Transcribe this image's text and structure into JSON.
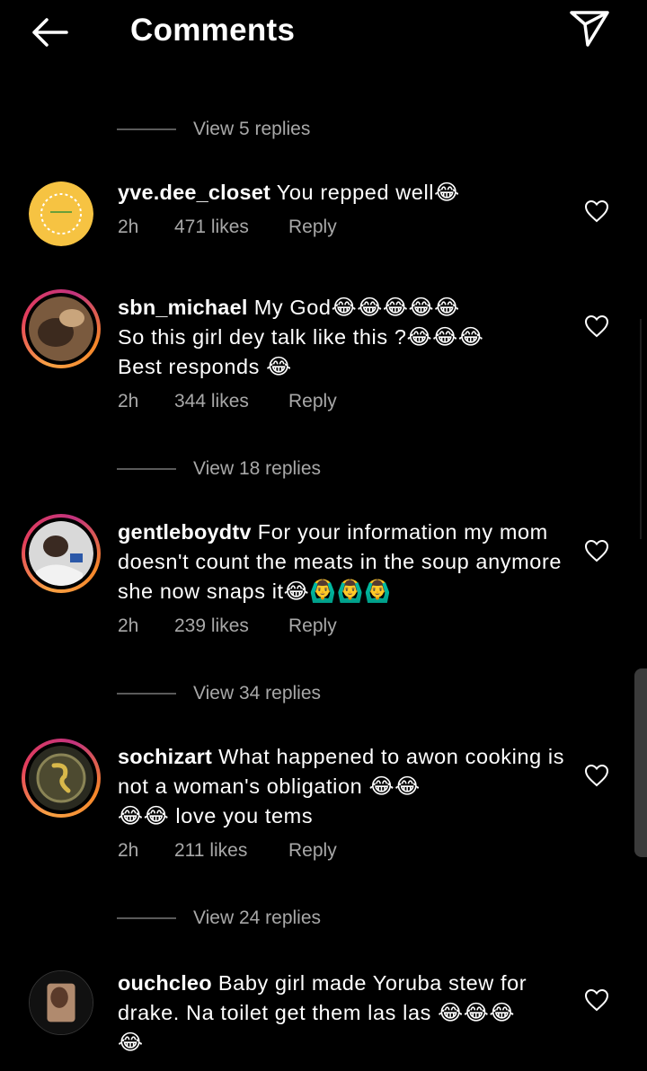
{
  "header": {
    "title": "Comments",
    "back_icon": "arrow-left-icon",
    "share_icon": "paper-plane-icon"
  },
  "view_replies": [
    "View 5 replies",
    "View 18 replies",
    "View 34 replies",
    "View 24 replies"
  ],
  "comments": [
    {
      "username": "yve.dee_closet",
      "text": "You repped well",
      "emoji": "😂",
      "time": "2h",
      "likes": "471 likes",
      "reply": "Reply"
    },
    {
      "username": "sbn_michael",
      "text1": "My God",
      "emoji1": "😂😂😂😂😂",
      "text2": "So this girl dey talk like this ?",
      "emoji2": "😂😂😂",
      "text3": "Best responds ",
      "emoji3": "😂",
      "time": "2h",
      "likes": "344 likes",
      "reply": "Reply"
    },
    {
      "username": "gentleboydtv",
      "text": "For your information my mom doesn't count the meats in the soup anymore she now snaps it",
      "emoji": "😂🙆‍♂️🙆‍♂️🙆‍♂️",
      "time": "2h",
      "likes": "239 likes",
      "reply": "Reply"
    },
    {
      "username": "sochizart",
      "text": "What happened to awon cooking is not a woman's obligation ",
      "emoji1": "😂😂",
      "emoji2": "😂😂",
      "text2": " love you tems",
      "time": "2h",
      "likes": "211 likes",
      "reply": "Reply"
    },
    {
      "username": "ouchcleo",
      "text": "Baby girl made Yoruba stew for drake. Na toilet get them las las ",
      "emoji": "😂😂😂",
      "emoji2": "😂"
    }
  ]
}
